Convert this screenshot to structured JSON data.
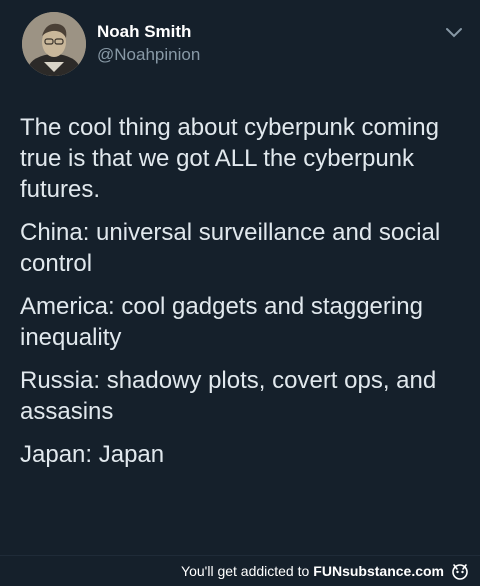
{
  "tweet": {
    "author_name": "Noah Smith",
    "author_handle": "@Noahpinion",
    "paragraphs": [
      "The cool thing about cyberpunk coming true is that we got ALL the cyberpunk futures.",
      "China: universal surveillance and social control",
      "America: cool gadgets and staggering inequality",
      "Russia: shadowy plots, covert ops, and assasins",
      "Japan: Japan"
    ]
  },
  "icons": {
    "avatar": "profile-photo",
    "menu": "chevron-down-icon",
    "footer": "funsubstance-logo-icon"
  },
  "footer": {
    "tagline": "You'll get addicted to",
    "brand": "FUNsubstance.com"
  },
  "colors": {
    "background": "#15202b",
    "text": "#e1e8ed",
    "handle": "#8899a6"
  }
}
